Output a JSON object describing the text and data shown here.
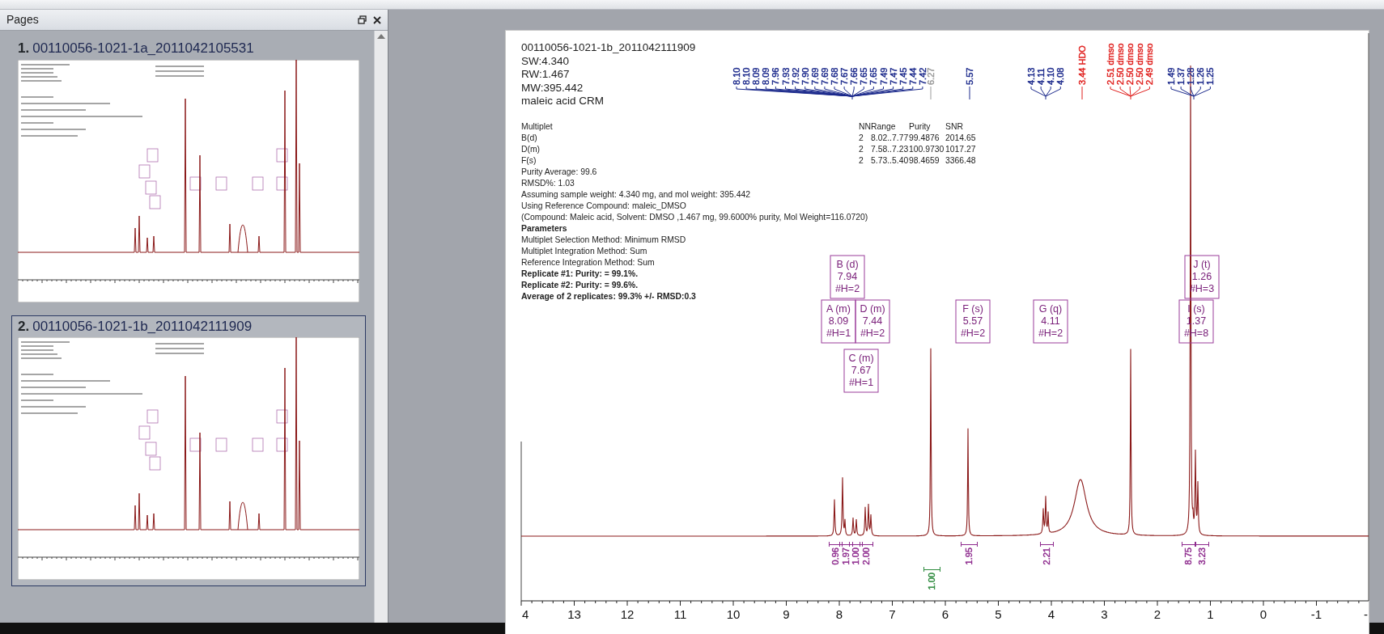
{
  "pages_panel": {
    "title": "Pages",
    "pages": [
      {
        "number": "1.",
        "name": "00110056-1021-1a_2011042105531",
        "selected": false
      },
      {
        "number": "2.",
        "name": "00110056-1021-1b_2011042111909",
        "selected": true
      }
    ]
  },
  "report": {
    "header_lines": [
      "00110056-1021-1b_2011042111909",
      "SW:4.340",
      "RW:1.467",
      "MW:395.442",
      "maleic acid CRM"
    ],
    "table": {
      "columns": [
        "Multiplet",
        "NN",
        "Range",
        "Purity",
        "SNR"
      ],
      "rows": [
        [
          "B(d)",
          "2",
          "8.02..7.77",
          "99.4876",
          "2014.65"
        ],
        [
          "D(m)",
          "2",
          "7.58..7.23",
          "100.9730",
          "1017.27"
        ],
        [
          "F(s)",
          "2",
          "5.73..5.40",
          "98.4659",
          "3366.48"
        ]
      ]
    },
    "lines": [
      {
        "text": "Purity Average: 99.6",
        "bold": false
      },
      {
        "text": "RMSD%:  1.03",
        "bold": false
      },
      {
        "text": "Assuming sample weight:  4.340  mg,  and mol weight:  395.442",
        "bold": false
      },
      {
        "text": "Using Reference Compound:  maleic_DMSO",
        "bold": false
      },
      {
        "text": "(Compound:  Maleic acid,  Solvent:  DMSO ,1.467 mg,  99.6000% purity,  Mol Weight=116.0720)",
        "bold": false
      },
      {
        "text": "Parameters",
        "bold": true
      },
      {
        "text": "Multiplet Selection Method:  Minimum RMSD",
        "bold": false
      },
      {
        "text": "Multiplet Integration Method:  Sum",
        "bold": false
      },
      {
        "text": "Reference Integration Method:  Sum",
        "bold": false
      },
      {
        "text": "Replicate #1: Purity:  = 99.1%.",
        "bold": true
      },
      {
        "text": "Replicate #2: Purity:  = 99.6%.",
        "bold": true
      },
      {
        "text": "Average of 2 replicates: 99.3% +/- RMSD:0.3",
        "bold": true
      }
    ]
  },
  "spectrum": {
    "peak_groups": [
      {
        "labels": [
          {
            "text": "8.10",
            "color": "#1c2a8c"
          },
          {
            "text": "8.10",
            "color": "#1c2a8c"
          },
          {
            "text": "8.09",
            "color": "#1c2a8c"
          },
          {
            "text": "8.09",
            "color": "#1c2a8c"
          },
          {
            "text": "7.96",
            "color": "#1c2a8c"
          },
          {
            "text": "7.93",
            "color": "#1c2a8c"
          },
          {
            "text": "7.92",
            "color": "#1c2a8c"
          },
          {
            "text": "7.90",
            "color": "#1c2a8c"
          },
          {
            "text": "7.69",
            "color": "#1c2a8c"
          },
          {
            "text": "7.69",
            "color": "#1c2a8c"
          },
          {
            "text": "7.68",
            "color": "#1c2a8c"
          },
          {
            "text": "7.67",
            "color": "#1c2a8c"
          },
          {
            "text": "7.66",
            "color": "#1c2a8c"
          },
          {
            "text": "7.65",
            "color": "#1c2a8c"
          },
          {
            "text": "7.65",
            "color": "#1c2a8c"
          },
          {
            "text": "7.49",
            "color": "#1c2a8c"
          },
          {
            "text": "7.47",
            "color": "#1c2a8c"
          },
          {
            "text": "7.45",
            "color": "#1c2a8c"
          },
          {
            "text": "7.44",
            "color": "#1c2a8c"
          },
          {
            "text": "7.42",
            "color": "#1c2a8c"
          }
        ]
      },
      {
        "labels": [
          {
            "text": "6.27",
            "color": "#9a9a9a"
          }
        ]
      },
      {
        "labels": [
          {
            "text": "5.57",
            "color": "#1c2a8c"
          }
        ]
      },
      {
        "labels": [
          {
            "text": "4.13",
            "color": "#1c2a8c"
          },
          {
            "text": "4.11",
            "color": "#1c2a8c"
          },
          {
            "text": "4.10",
            "color": "#1c2a8c"
          },
          {
            "text": "4.08",
            "color": "#1c2a8c"
          }
        ]
      },
      {
        "labels": [
          {
            "text": "3.44 HDO",
            "color": "#e0201e"
          }
        ]
      },
      {
        "labels": [
          {
            "text": "2.51 dmso",
            "color": "#e0201e"
          },
          {
            "text": "2.50 dmso",
            "color": "#e0201e"
          },
          {
            "text": "2.50 dmso",
            "color": "#e0201e"
          },
          {
            "text": "2.50 dmso",
            "color": "#e0201e"
          },
          {
            "text": "2.49 dmso",
            "color": "#e0201e"
          }
        ]
      },
      {
        "labels": [
          {
            "text": "1.49",
            "color": "#1c2a8c"
          },
          {
            "text": "1.37",
            "color": "#1c2a8c"
          },
          {
            "text": "1.28",
            "color": "#1c2a8c"
          },
          {
            "text": "1.26",
            "color": "#1c2a8c"
          },
          {
            "text": "1.25",
            "color": "#1c2a8c"
          }
        ]
      }
    ],
    "multiplets": [
      {
        "name": "B (d)",
        "shift": "7.94",
        "hydrogens": "#H=2"
      },
      {
        "name": "A (m)",
        "shift": "8.09",
        "hydrogens": "#H=1"
      },
      {
        "name": "D (m)",
        "shift": "7.44",
        "hydrogens": "#H=2"
      },
      {
        "name": "C (m)",
        "shift": "7.67",
        "hydrogens": "#H=1"
      },
      {
        "name": "F (s)",
        "shift": "5.57",
        "hydrogens": "#H=2"
      },
      {
        "name": "G (q)",
        "shift": "4.11",
        "hydrogens": "#H=2"
      },
      {
        "name": "J (t)",
        "shift": "1.26",
        "hydrogens": "#H=3"
      },
      {
        "name": "I (s)",
        "shift": "1.37",
        "hydrogens": "#H=8"
      }
    ],
    "integrals": [
      {
        "text": "0.96",
        "color": "#8e2b8e"
      },
      {
        "text": "1.97",
        "color": "#8e2b8e"
      },
      {
        "text": "1.00",
        "color": "#8e2b8e"
      },
      {
        "text": "2.00",
        "color": "#8e2b8e"
      },
      {
        "text": "1.00",
        "color": "#2e8b3e"
      },
      {
        "text": "1.95",
        "color": "#8e2b8e"
      },
      {
        "text": "2.21",
        "color": "#8e2b8e"
      },
      {
        "text": "8.75",
        "color": "#8e2b8e"
      },
      {
        "text": "3.23",
        "color": "#8e2b8e"
      }
    ],
    "axis_labels": [
      "4",
      "13",
      "12",
      "11",
      "10",
      "9",
      "8",
      "7",
      "6",
      "5",
      "4",
      "3",
      "2",
      "1",
      "0",
      "-1",
      "-"
    ]
  }
}
